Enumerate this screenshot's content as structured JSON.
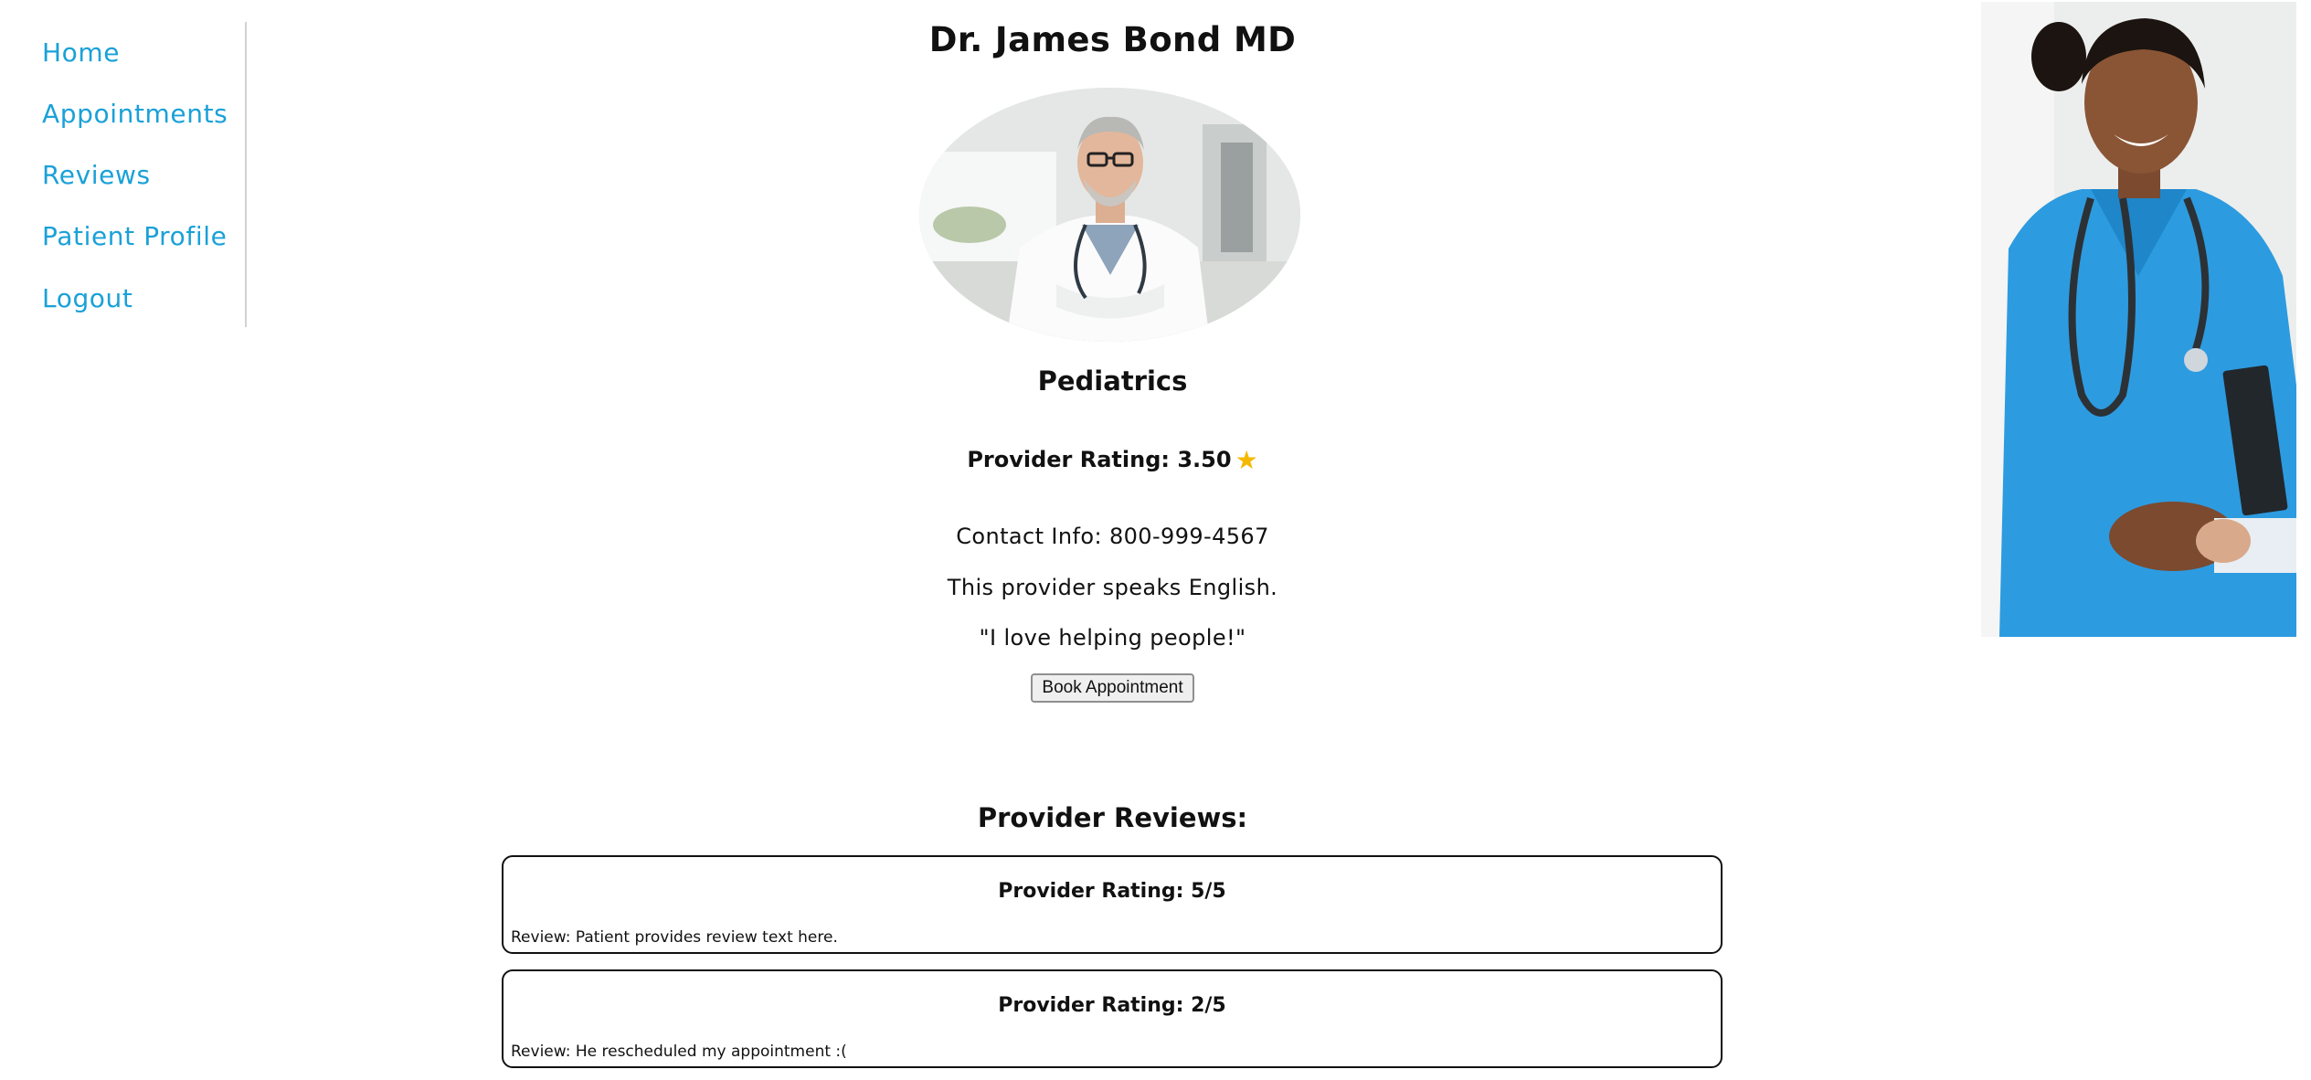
{
  "sidebar": {
    "items": [
      {
        "label": "Home"
      },
      {
        "label": "Appointments"
      },
      {
        "label": "Reviews"
      },
      {
        "label": "Patient Profile"
      },
      {
        "label": "Logout"
      }
    ],
    "link_color": "#1aa1d8"
  },
  "provider": {
    "name": "Dr. James Bond MD",
    "photo": "doctor-portrait",
    "specialty": "Pediatrics",
    "rating_label": "Provider Rating: 3.50",
    "rating_value": 3.5,
    "rating_icon": "star-icon",
    "contact": "Contact Info: 800-999-4567",
    "language": "This provider speaks English.",
    "quote": "\"I love helping people!\"",
    "book_button": "Book Appointment"
  },
  "reviews": {
    "title": "Provider Reviews:",
    "items": [
      {
        "rating": "Provider Rating: 5/5",
        "text": "Review: Patient provides review text here."
      },
      {
        "rating": "Provider Rating: 2/5",
        "text": "Review: He rescheduled my appointment :("
      }
    ]
  },
  "side_image": "nurse-handshake-photo",
  "colors": {
    "accent": "#1aa1d8",
    "star": "#f5b800",
    "scrubs": "#2d9be0"
  }
}
